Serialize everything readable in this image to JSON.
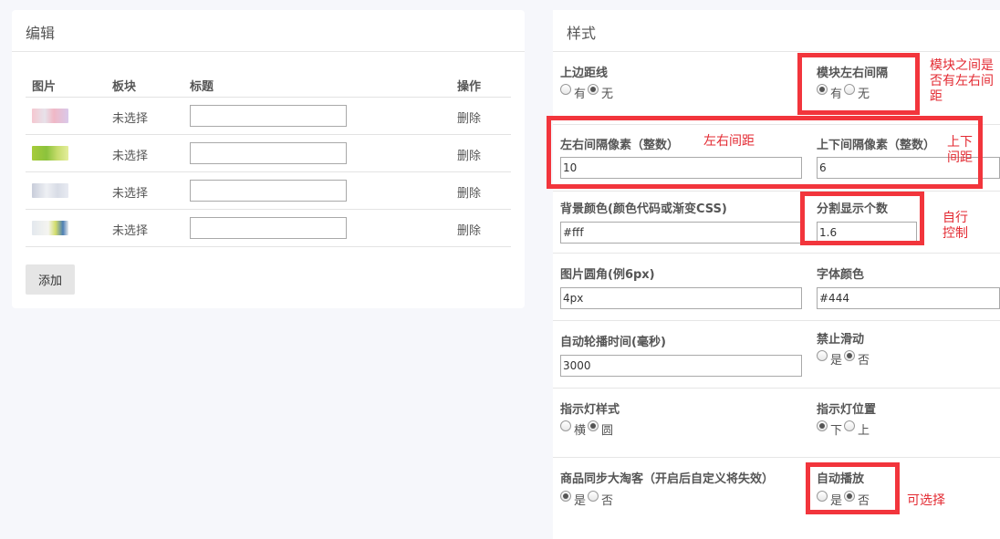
{
  "edit_panel": {
    "title": "编辑",
    "columns": [
      "图片",
      "板块",
      "标题",
      "操作"
    ],
    "rows": [
      {
        "thumb": "banner-thumb-1",
        "block": "未选择",
        "title": "",
        "action": "删除"
      },
      {
        "thumb": "banner-thumb-2",
        "block": "未选择",
        "title": "",
        "action": "删除"
      },
      {
        "thumb": "banner-thumb-3",
        "block": "未选择",
        "title": "",
        "action": "删除"
      },
      {
        "thumb": "banner-thumb-4",
        "block": "未选择",
        "title": "",
        "action": "删除"
      }
    ],
    "add_label": "添加"
  },
  "style_panel": {
    "title": "样式",
    "top_border": {
      "label": "上边距线",
      "options": [
        "有",
        "无"
      ],
      "selected": "无"
    },
    "module_spacing": {
      "label": "模块左右间隔",
      "options": [
        "有",
        "无"
      ],
      "selected": "有"
    },
    "h_gap": {
      "label": "左右间隔像素（整数）",
      "value": "10"
    },
    "v_gap": {
      "label": "上下间隔像素（整数）",
      "value": "6"
    },
    "bg_color": {
      "label": "背景颜色(颜色代码或渐变CSS)",
      "value": "#fff"
    },
    "split_count": {
      "label": "分割显示个数",
      "value": "1.6"
    },
    "img_radius": {
      "label": "图片圆角(例6px)",
      "value": "4px"
    },
    "font_color": {
      "label": "字体颜色",
      "value": "#444"
    },
    "autoplay_time": {
      "label": "自动轮播时间(毫秒)",
      "value": "3000"
    },
    "disable_scroll": {
      "label": "禁止滑动",
      "options": [
        "是",
        "否"
      ],
      "selected": "否"
    },
    "indicator_style": {
      "label": "指示灯样式",
      "options": [
        "横",
        "圆"
      ],
      "selected": "圆"
    },
    "indicator_pos": {
      "label": "指示灯位置",
      "options": [
        "下",
        "上"
      ],
      "selected": "下"
    },
    "sync_taoke": {
      "label": "商品同步大淘客（开启后自定义将失效）",
      "options": [
        "是",
        "否"
      ],
      "selected": "是"
    },
    "autoplay": {
      "label": "自动播放",
      "options": [
        "是",
        "否"
      ],
      "selected": "否"
    }
  },
  "annotations": {
    "module_spacing": "模块之间是否有左右间距",
    "h_gap": "左右间距",
    "v_gap": "上下间距",
    "split": "自行控制",
    "autoplay": "可选择"
  },
  "colors": {
    "annotation_red": "#f2353c",
    "panel_bg": "#ffffff",
    "page_bg": "#f6f7fb"
  }
}
